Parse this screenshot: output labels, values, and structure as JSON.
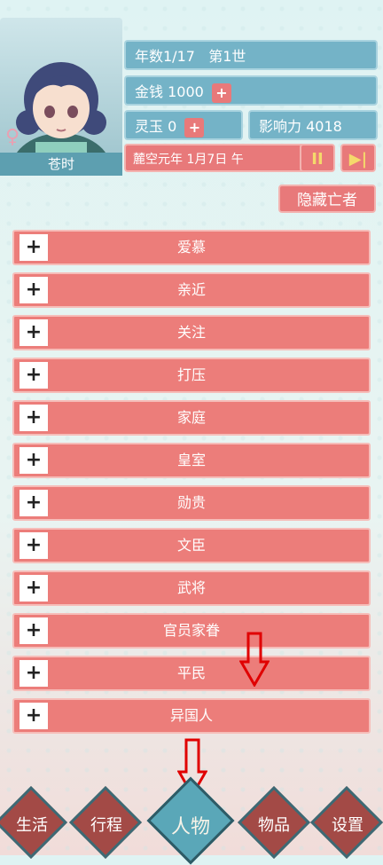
{
  "character": {
    "name": "苍时",
    "gender_symbol": "♀"
  },
  "stats": {
    "year_label": "年数1/17",
    "generation_label": "第1世",
    "money_label": "金钱",
    "money_value": "1000",
    "jade_label": "灵玉",
    "jade_value": "0",
    "influence_label": "影响力",
    "influence_value": "4018",
    "plus_symbol": "+"
  },
  "date_text": "麓空元年 1月7日 午",
  "controls": {
    "pause": "II",
    "fast_forward": "▶|"
  },
  "hide_dead_label": "隐藏亡者",
  "categories": [
    "爱慕",
    "亲近",
    "关注",
    "打压",
    "家庭",
    "皇室",
    "勋贵",
    "文臣",
    "武将",
    "官员家眷",
    "平民",
    "异国人"
  ],
  "expand_symbol": "+",
  "nav": [
    {
      "label": "生活"
    },
    {
      "label": "行程"
    },
    {
      "label": "人物"
    },
    {
      "label": "物品"
    },
    {
      "label": "设置"
    }
  ],
  "colors": {
    "accent_red": "#e8797a",
    "accent_blue": "#74b3c7",
    "annotation_red": "#e00000"
  }
}
